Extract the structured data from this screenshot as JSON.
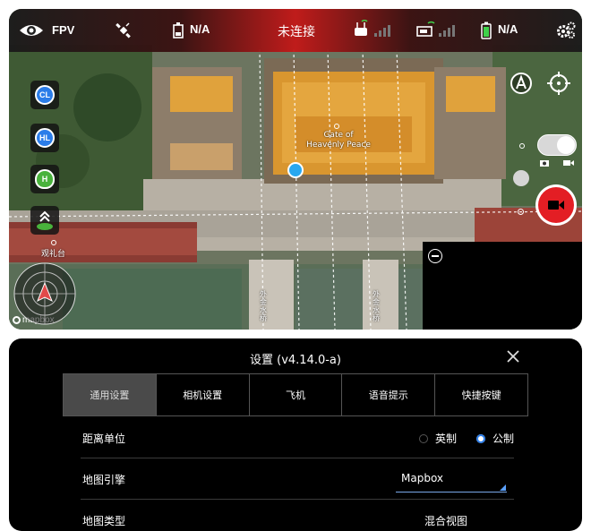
{
  "topbar": {
    "mode_label": "FPV",
    "gps_value": "N/A",
    "connection_status": "未连接",
    "battery_value": "N/A"
  },
  "map": {
    "landmark_label": "Gate of Heavenly Peace",
    "poi_guanlitai": "观礼台",
    "bridge_label_left": "外金水桥",
    "bridge_label_right": "外金水桥",
    "attribution": "mapbox"
  },
  "left_controls": {
    "cl_label": "CL",
    "hl_label": "HL",
    "home_label": "H"
  },
  "settings": {
    "title": "设置 (v4.14.0-a)",
    "tabs": [
      {
        "label": "通用设置",
        "active": true
      },
      {
        "label": "相机设置",
        "active": false
      },
      {
        "label": "飞机",
        "active": false
      },
      {
        "label": "语音提示",
        "active": false
      },
      {
        "label": "快捷按键",
        "active": false
      }
    ],
    "rows": {
      "distance_unit": {
        "label": "距离单位",
        "option_imperial": "英制",
        "option_metric": "公制",
        "selected": "公制"
      },
      "map_engine": {
        "label": "地图引擎",
        "value": "Mapbox"
      },
      "map_type": {
        "label": "地图类型",
        "value": "混合视图"
      }
    }
  },
  "colors": {
    "accent_blue": "#2b7de9",
    "record_red": "#e31e24",
    "topbar_red": "#c31818",
    "home_green": "#49b23c"
  }
}
